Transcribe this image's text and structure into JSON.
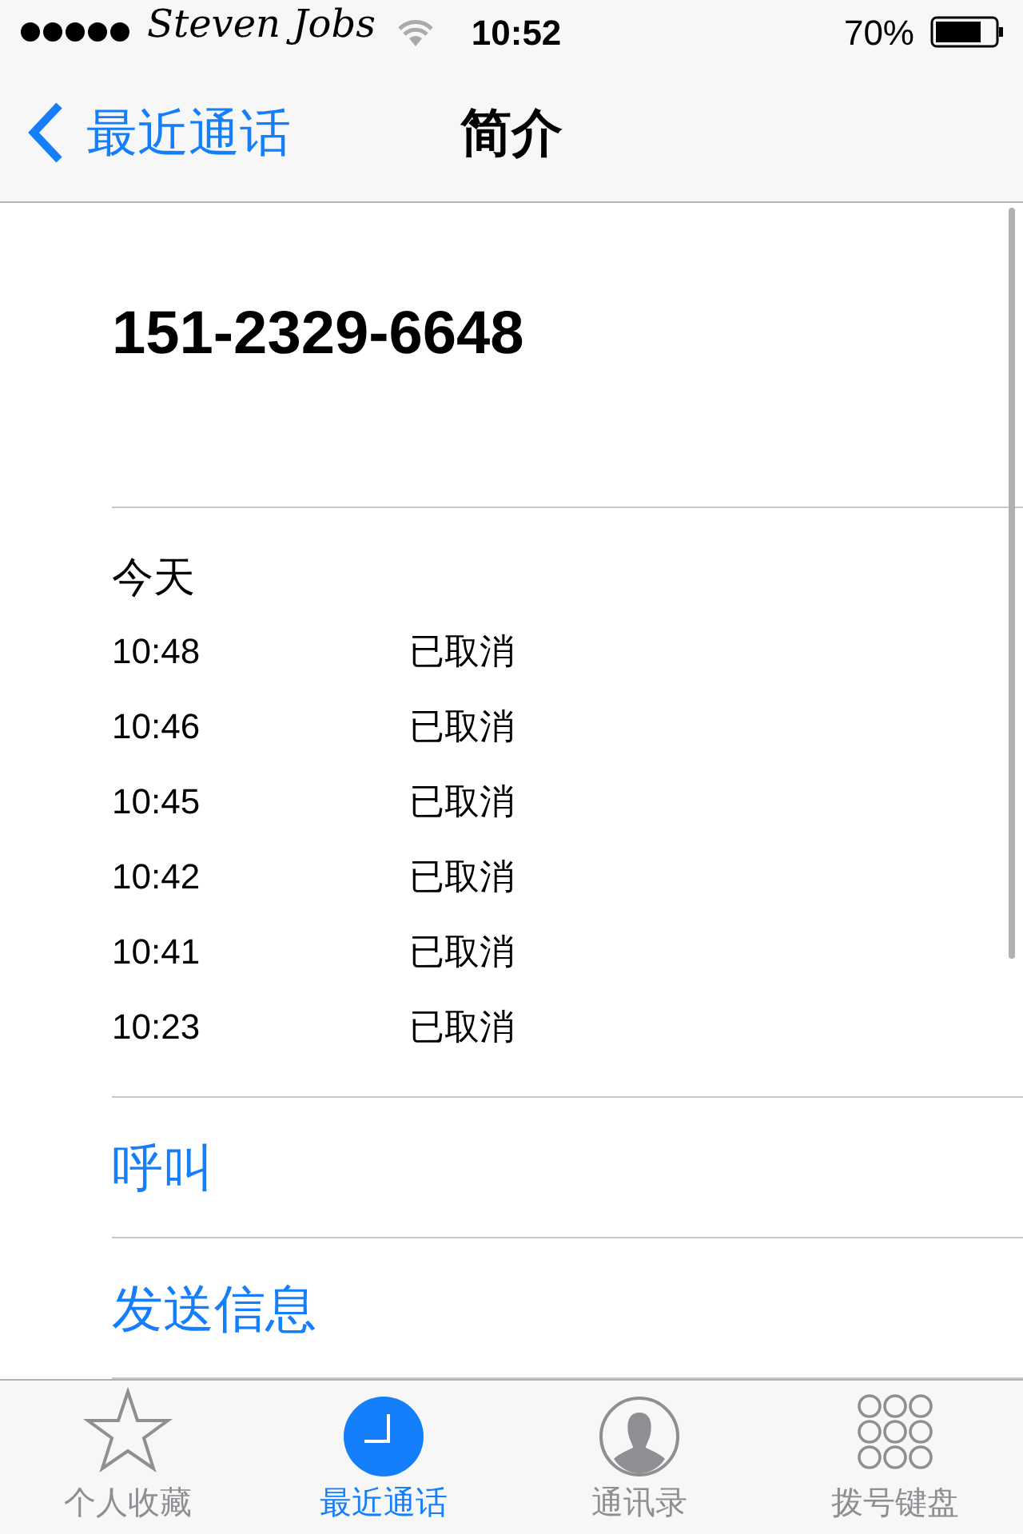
{
  "status_bar": {
    "carrier": "Steven Jobs",
    "time": "10:52",
    "battery": "70%"
  },
  "nav_bar": {
    "back": "最近通话",
    "title": "简介"
  },
  "contact": {
    "number": "151-2329-6648"
  },
  "calls": {
    "heading": "今天",
    "rows": [
      {
        "time": "10:48",
        "status": "已取消"
      },
      {
        "time": "10:46",
        "status": "已取消"
      },
      {
        "time": "10:45",
        "status": "已取消"
      },
      {
        "time": "10:42",
        "status": "已取消"
      },
      {
        "time": "10:41",
        "status": "已取消"
      },
      {
        "time": "10:23",
        "status": "已取消"
      }
    ]
  },
  "actions": [
    "呼叫",
    "发送信息"
  ],
  "tab_bar": [
    {
      "kind": "favorites",
      "label": "个人收藏",
      "selected": false
    },
    {
      "kind": "recents",
      "label": "最近通话",
      "selected": true
    },
    {
      "kind": "contacts",
      "label": "通讯录",
      "selected": false
    },
    {
      "kind": "keypad",
      "label": "拨号键盘",
      "selected": false
    }
  ]
}
